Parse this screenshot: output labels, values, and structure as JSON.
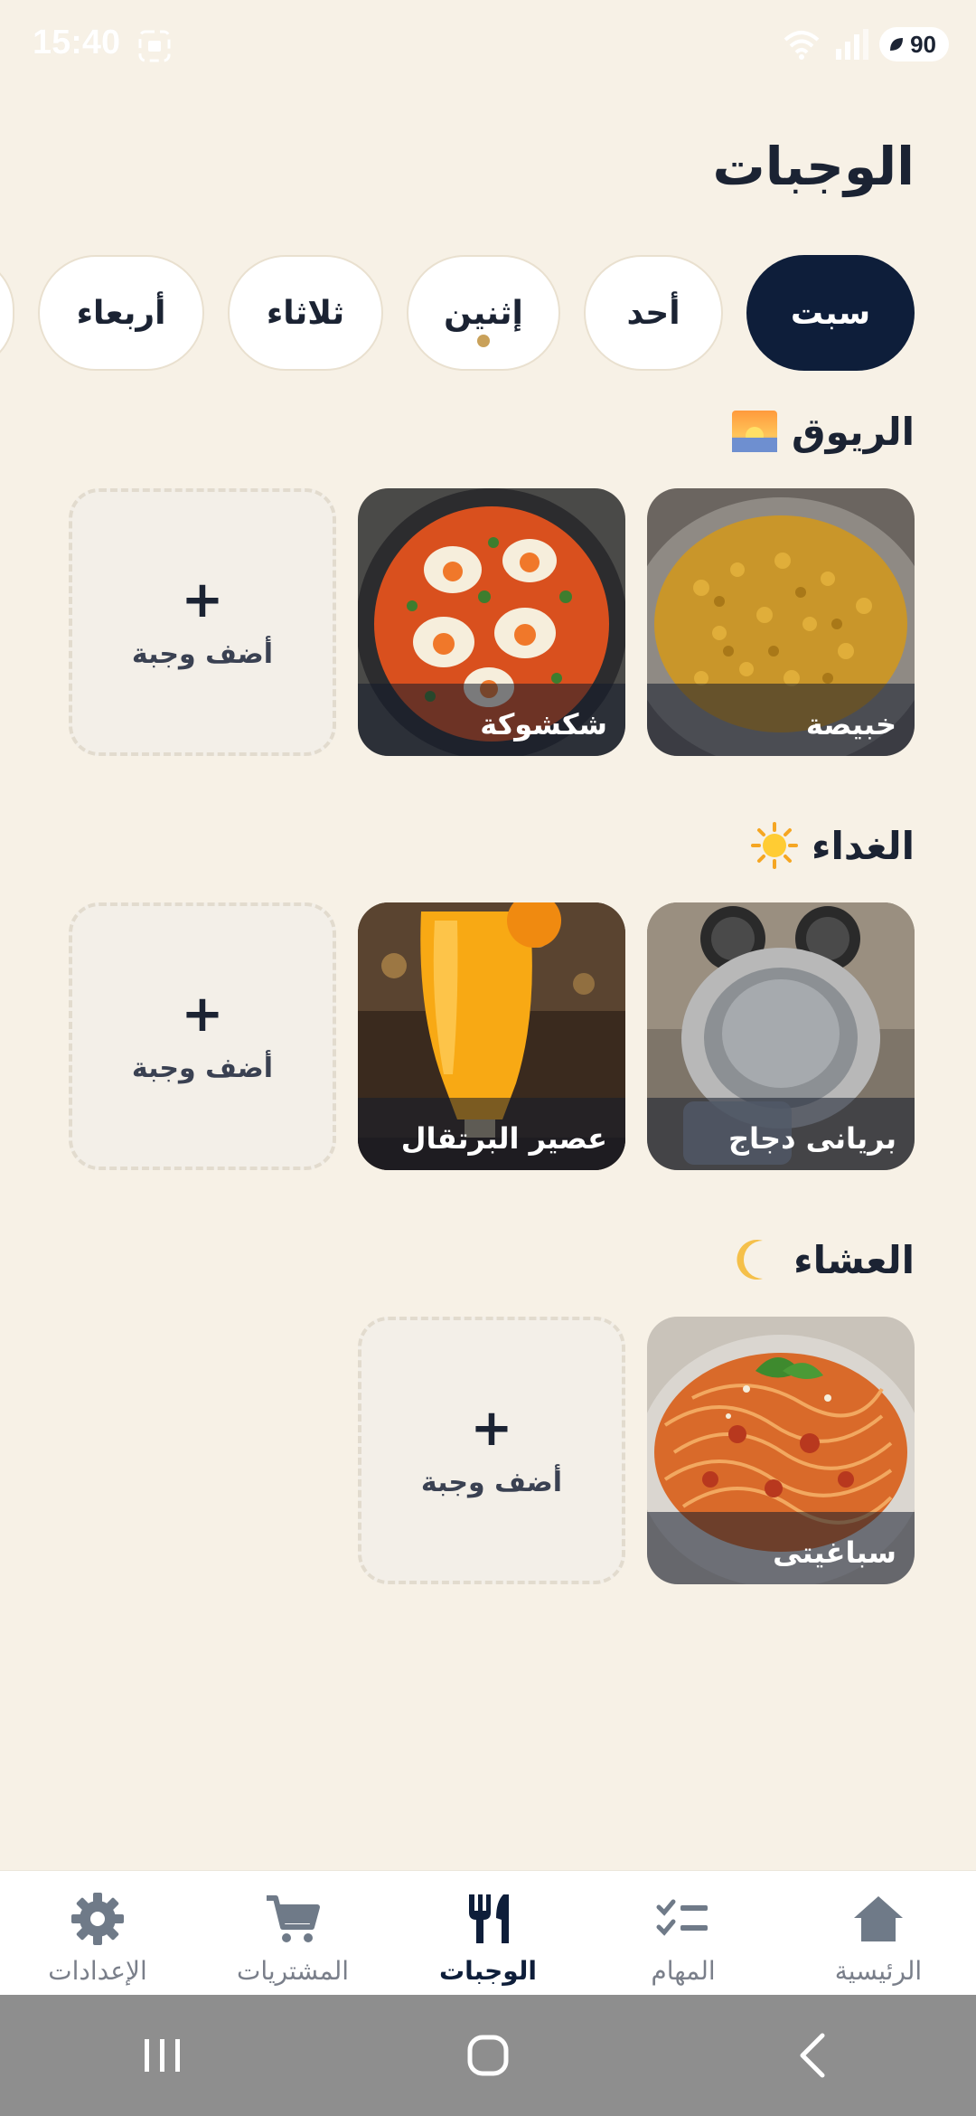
{
  "status": {
    "time": "15:40",
    "battery": "90"
  },
  "title": "الوجبات",
  "days": [
    {
      "label": "سبت",
      "active": true,
      "dot": false
    },
    {
      "label": "أحد",
      "active": false,
      "dot": false
    },
    {
      "label": "إثنين",
      "active": false,
      "dot": true
    },
    {
      "label": "ثلاثاء",
      "active": false,
      "dot": false
    },
    {
      "label": "أربعاء",
      "active": false,
      "dot": false
    }
  ],
  "sections": {
    "breakfast": {
      "title": "الريوق",
      "emoji": "sunrise-icon",
      "meals": [
        "خبيصة",
        "شكشوكة"
      ]
    },
    "lunch": {
      "title": "الغداء",
      "emoji": "sun-icon",
      "meals": [
        "بريانى دجاج",
        "عصير البرتقال"
      ]
    },
    "dinner": {
      "title": "العشاء",
      "emoji": "crescent-moon-icon",
      "meals": [
        "سباغيتى"
      ]
    }
  },
  "add_meal_label": "أضف وجبة",
  "add_meal_plus": "+",
  "nav": {
    "home": "الرئيسية",
    "tasks": "المهام",
    "meals": "الوجبات",
    "purchases": "المشتريات",
    "settings": "الإعدادات",
    "active": "meals"
  },
  "colors": {
    "background": "#F7F1E6",
    "primary": "#0E1E3A",
    "accent_dot": "#C9A15A"
  }
}
